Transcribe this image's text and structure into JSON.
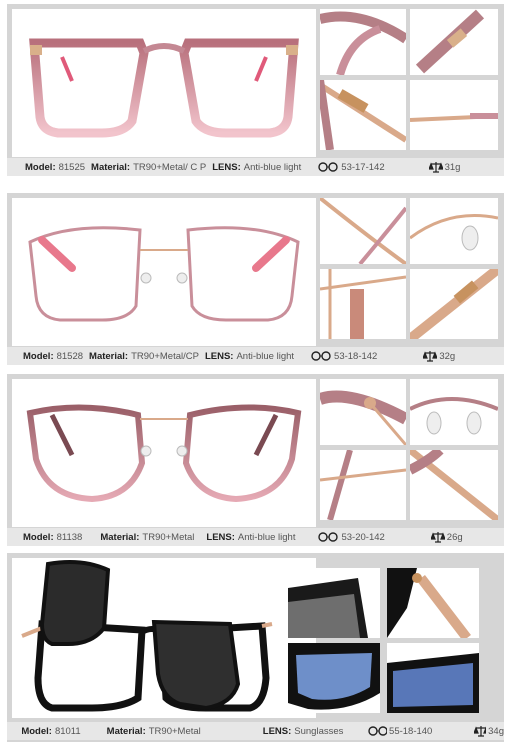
{
  "labels": {
    "model": "Model:",
    "material": "Material:",
    "lens": "LENS:"
  },
  "products": [
    {
      "model": "81525",
      "material": "TR90+Metal/ C P",
      "lens": "Anti-blue light",
      "size": "53-17-142",
      "weight": "31g"
    },
    {
      "model": "81528",
      "material": "TR90+Metal/CP",
      "lens": "Anti-blue light",
      "size": "53-18-142",
      "weight": "32g"
    },
    {
      "model": "81138",
      "material": "TR90+Metal",
      "lens": "Anti-blue light",
      "size": "53-20-142",
      "weight": "26g"
    },
    {
      "model": "81011",
      "material": "TR90+Metal",
      "lens": "Sunglasses",
      "size": "55-18-140",
      "weight": "34g"
    }
  ],
  "icons": {
    "size": "glasses-icon",
    "weight": "scale-icon"
  },
  "colors": {
    "frame_pink": "#c98f9a",
    "frame_rose": "#b57f86",
    "frame_gold": "#d9a98a",
    "frame_black": "#111111",
    "lens_blue": "#6e8fc9",
    "info_bar": "#e7e7e7"
  }
}
